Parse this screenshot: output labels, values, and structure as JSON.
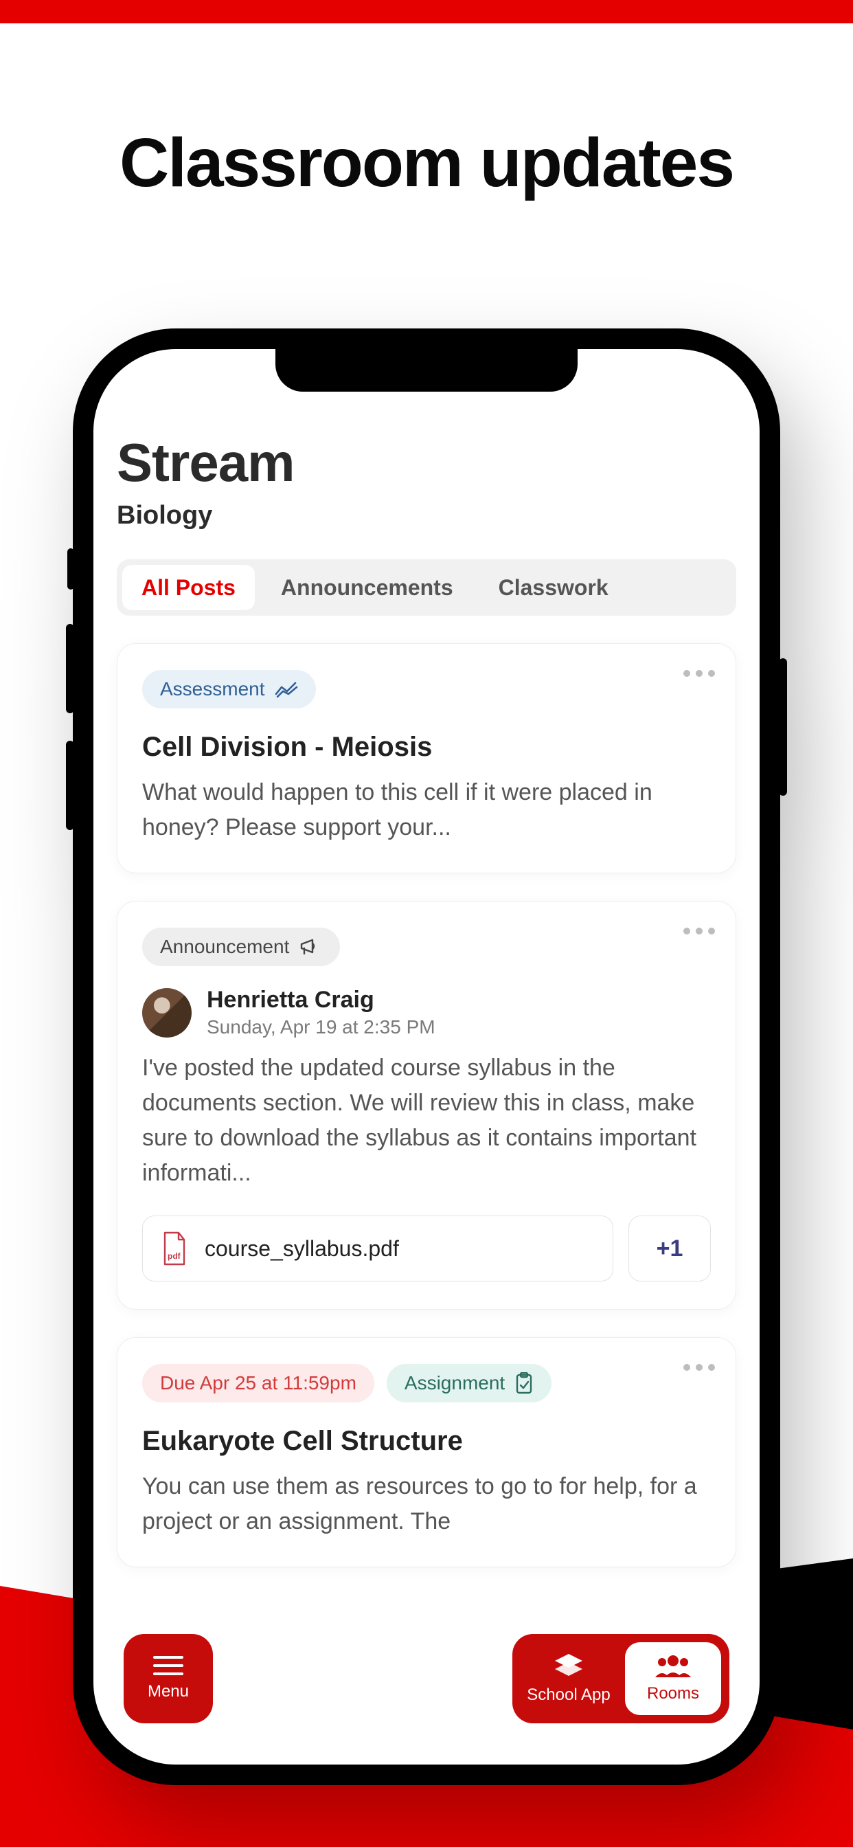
{
  "marketing_headline": "Classroom updates",
  "page": {
    "title": "Stream",
    "subject": "Biology"
  },
  "tabs": {
    "all_posts": "All Posts",
    "announcements": "Announcements",
    "classwork": "Classwork"
  },
  "cards": {
    "assessment": {
      "chip": "Assessment",
      "title": "Cell Division - Meiosis",
      "body": "What would happen to this cell if it were placed in honey? Please support your..."
    },
    "announcement": {
      "chip": "Announcement",
      "author": "Henrietta Craig",
      "timestamp": "Sunday, Apr 19 at 2:35 PM",
      "body": "I've posted the updated course syllabus in the documents section. We will review this in class, make sure to download the syllabus as it contains important informati...",
      "attachment_name": "course_syllabus.pdf",
      "attachment_more": "+1"
    },
    "assignment": {
      "due": "Due Apr 25 at 11:59pm",
      "chip": "Assignment",
      "title": "Eukaryote Cell Structure",
      "body": "You can use them as resources to go to for help, for a project or an assignment. The"
    }
  },
  "nav": {
    "menu": "Menu",
    "school_app": "School App",
    "rooms": "Rooms"
  },
  "colors": {
    "brand_red": "#E50000",
    "fab_red": "#c60b0b"
  }
}
